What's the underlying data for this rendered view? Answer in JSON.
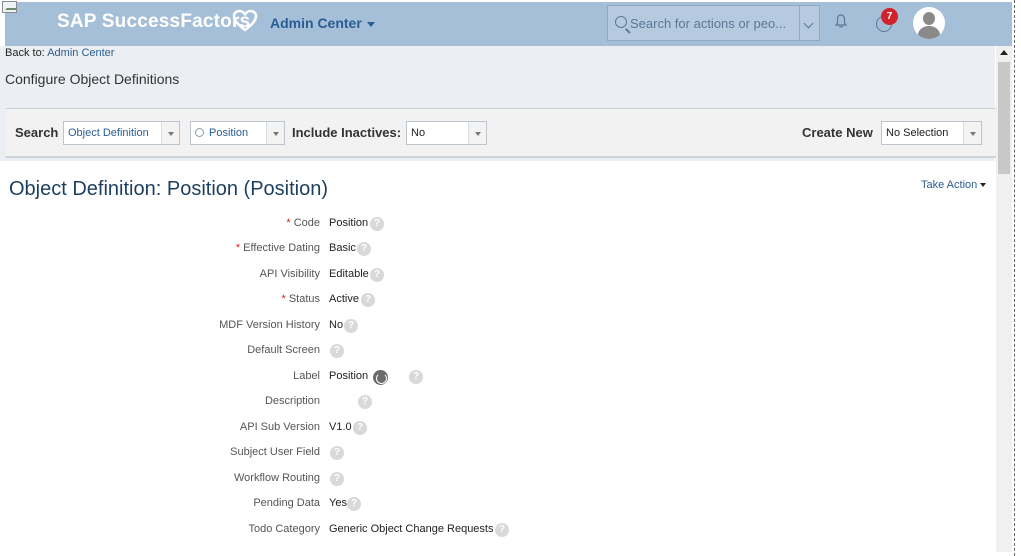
{
  "header": {
    "brand": "SAP SuccessFactors",
    "menu_label": "Admin Center",
    "search_placeholder": "Search for actions or peo...",
    "notification_count": "7"
  },
  "breadcrumb": {
    "prefix": "Back to:",
    "link": "Admin Center"
  },
  "page_title": "Configure Object Definitions",
  "toolbar": {
    "search_label": "Search",
    "object_type": "Object Definition",
    "object_name": "Position",
    "include_inactives_label": "Include Inactives:",
    "include_inactives_value": "No",
    "create_new_label": "Create New",
    "create_new_value": "No Selection"
  },
  "object": {
    "title": "Object Definition: Position (Position)",
    "take_action": "Take Action"
  },
  "fields": [
    {
      "label": "Code",
      "value": "Position",
      "required": true
    },
    {
      "label": "Effective Dating",
      "value": "Basic",
      "required": true
    },
    {
      "label": "API Visibility",
      "value": "Editable",
      "required": false
    },
    {
      "label": "Status",
      "value": "Active",
      "required": true
    },
    {
      "label": "MDF Version History",
      "value": "No",
      "required": false
    },
    {
      "label": "Default Screen",
      "value": "",
      "required": false
    },
    {
      "label": "Label",
      "value": "Position",
      "required": false
    },
    {
      "label": "Description",
      "value": "",
      "required": false
    },
    {
      "label": "API Sub Version",
      "value": "V1.0",
      "required": false
    },
    {
      "label": "Subject User Field",
      "value": "",
      "required": false
    },
    {
      "label": "Workflow Routing",
      "value": "",
      "required": false
    },
    {
      "label": "Pending Data",
      "value": "Yes",
      "required": false
    },
    {
      "label": "Todo Category",
      "value": "Generic Object Change Requests",
      "required": false
    }
  ],
  "required_marker": "*",
  "help_glyph": "?",
  "colors": {
    "shell": "#a6bfd8",
    "link": "#2a5d93",
    "title": "#1d3f5f",
    "required": "#d2232a",
    "badge": "#d2232a"
  }
}
